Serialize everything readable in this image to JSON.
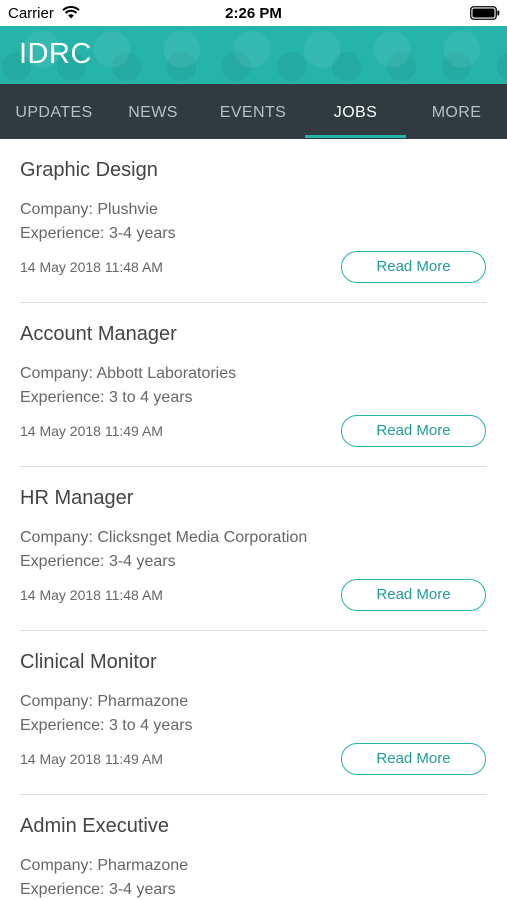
{
  "status_bar": {
    "carrier": "Carrier",
    "time": "2:26 PM",
    "icons": [
      "wifi-icon",
      "battery-icon"
    ]
  },
  "header": {
    "title": "IDRC",
    "color": "#25b3aa"
  },
  "tabs": [
    {
      "label": "UPDATES",
      "active": false
    },
    {
      "label": "NEWS",
      "active": false
    },
    {
      "label": "EVENTS",
      "active": false
    },
    {
      "label": "JOBS",
      "active": true
    },
    {
      "label": "MORE",
      "active": false
    }
  ],
  "jobs": [
    {
      "title": "Graphic Design",
      "company": "Company: Plushvie",
      "experience": "Experience: 3-4 years",
      "date": "14 May 2018 11:48 AM",
      "button": "Read More"
    },
    {
      "title": "Account Manager",
      "company": "Company: Abbott Laboratories",
      "experience": "Experience: 3 to 4 years",
      "date": "14 May 2018 11:49 AM",
      "button": "Read More"
    },
    {
      "title": "HR Manager",
      "company": "Company: Clicksnget Media Corporation",
      "experience": "Experience: 3-4 years",
      "date": "14 May 2018 11:48 AM",
      "button": "Read More"
    },
    {
      "title": "Clinical Monitor",
      "company": "Company: Pharmazone",
      "experience": "Experience: 3 to 4 years",
      "date": "14 May 2018 11:49 AM",
      "button": "Read More"
    },
    {
      "title": "Admin Executive",
      "company": "Company: Pharmazone",
      "experience": "Experience: 3-4 years"
    }
  ],
  "colors": {
    "accent": "#25b3aa",
    "tab_bar": "#2f3b3f"
  }
}
